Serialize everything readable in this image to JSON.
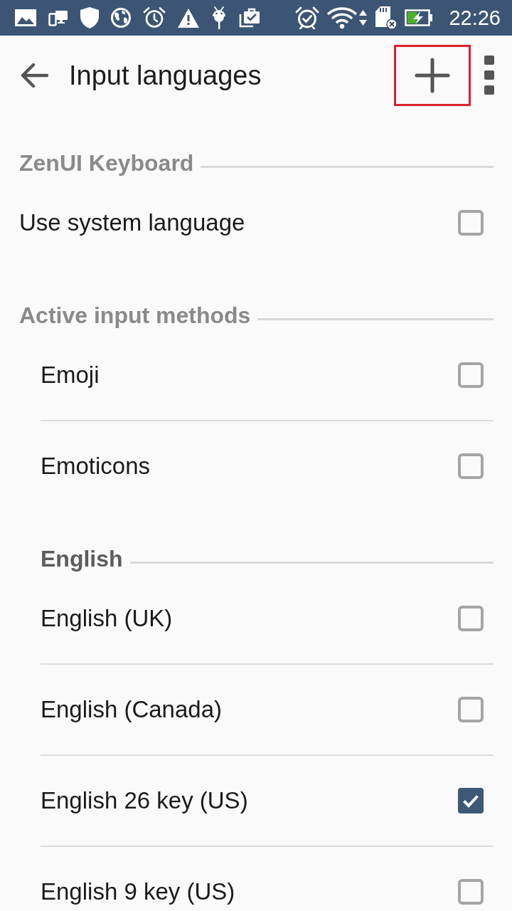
{
  "status_bar": {
    "time": "22:26"
  },
  "app_bar": {
    "title": "Input languages",
    "add_button_highlighted": true
  },
  "sections": [
    {
      "kind": "preferences",
      "title": "ZenUI Keyboard",
      "items": [
        {
          "kind": "option",
          "label": "Use system language",
          "checked": false
        }
      ]
    },
    {
      "kind": "input_methods",
      "title": "Active input methods",
      "items": [
        {
          "kind": "option",
          "label": "Emoji",
          "checked": false
        },
        {
          "kind": "option",
          "label": "Emoticons",
          "checked": false
        },
        {
          "kind": "group",
          "title": "English",
          "children": [
            {
              "kind": "option",
              "label": "English (UK)",
              "checked": false
            },
            {
              "kind": "option",
              "label": "English (Canada)",
              "checked": false
            },
            {
              "kind": "option",
              "label": "English 26 key (US)",
              "checked": true
            },
            {
              "kind": "option",
              "label": "English 9 key (US)",
              "checked": false
            }
          ]
        }
      ]
    }
  ]
}
